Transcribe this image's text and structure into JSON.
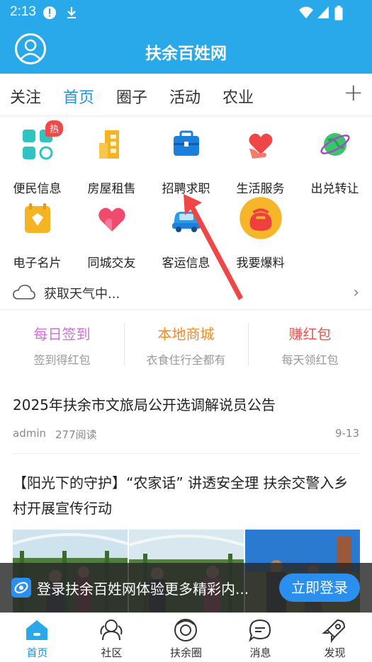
{
  "status_bar": {
    "time": "2:13"
  },
  "header": {
    "title": "扶余百姓网"
  },
  "tabs": [
    {
      "label": "关注"
    },
    {
      "label": "首页"
    },
    {
      "label": "圈子"
    },
    {
      "label": "活动"
    },
    {
      "label": "农业"
    }
  ],
  "grid": [
    {
      "label": "便民信息",
      "icon": "apps-icon",
      "badge": "热"
    },
    {
      "label": "房屋租售",
      "icon": "building-icon"
    },
    {
      "label": "招聘求职",
      "icon": "briefcase-icon"
    },
    {
      "label": "生活服务",
      "icon": "heart-hand-icon"
    },
    {
      "label": "出兑转让",
      "icon": "globe-icon"
    },
    {
      "label": "电子名片",
      "icon": "card-icon"
    },
    {
      "label": "同城交友",
      "icon": "heart-icon"
    },
    {
      "label": "客运信息",
      "icon": "car-icon"
    },
    {
      "label": "我要爆料",
      "icon": "bag-icon"
    }
  ],
  "weather": {
    "text": "获取天气中..."
  },
  "promos": [
    {
      "title": "每日签到",
      "subtitle": "签到得红包",
      "color": "#d26fd8"
    },
    {
      "title": "本地商城",
      "subtitle": "衣食住行全都有",
      "color": "#f28a26"
    },
    {
      "title": "赚红包",
      "subtitle": "每天领红包",
      "color": "#f25252"
    }
  ],
  "news": [
    {
      "title": "2025年扶余市文旅局公开选调解说员公告",
      "author": "admin",
      "reads": "277阅读",
      "date": "9-13"
    },
    {
      "title": "【阳光下的守护】“农家话” 讲透安全理 扶余交警入乡村开展宣传行动"
    }
  ],
  "login_banner": {
    "text": "登录扶余百姓网体验更多精彩内...",
    "button": "立即登录"
  },
  "bottom_nav": [
    {
      "label": "首页",
      "icon": "home-icon"
    },
    {
      "label": "社区",
      "icon": "community-icon"
    },
    {
      "label": "扶余圈",
      "icon": "circle-icon"
    },
    {
      "label": "消息",
      "icon": "message-icon"
    },
    {
      "label": "发现",
      "icon": "rocket-icon"
    }
  ],
  "colors": {
    "accent": "#29a8ea",
    "active_tab": "#1f93e0",
    "button": "#2b8ff0"
  }
}
